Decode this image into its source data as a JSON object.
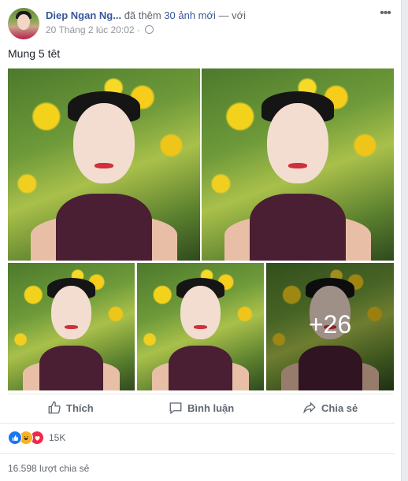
{
  "post": {
    "author": "Diep Ngan Ng...",
    "action_text": "đã thêm",
    "photo_count_link": "30 ảnh mới",
    "with_text": "— với",
    "date": "20 Tháng 2 lúc 20:02",
    "separator": "·",
    "text": "Mung 5 têt",
    "more_photos_label": "+26"
  },
  "actions": {
    "like_label": "Thích",
    "comment_label": "Bình luận",
    "share_label": "Chia sẻ"
  },
  "stats": {
    "reaction_count": "15K",
    "share_count": "16.598 lượt chia sẻ"
  },
  "icons": {
    "menu": "more-horizontal-icon",
    "privacy": "globe-icon",
    "like": "thumbs-up-icon",
    "comment": "comment-icon",
    "share": "share-arrow-icon"
  },
  "colors": {
    "link": "#365899",
    "secondary_text": "#616770",
    "like_reaction": "#1877f2",
    "haha_reaction": "#f7b125",
    "love_reaction": "#f0284a"
  }
}
